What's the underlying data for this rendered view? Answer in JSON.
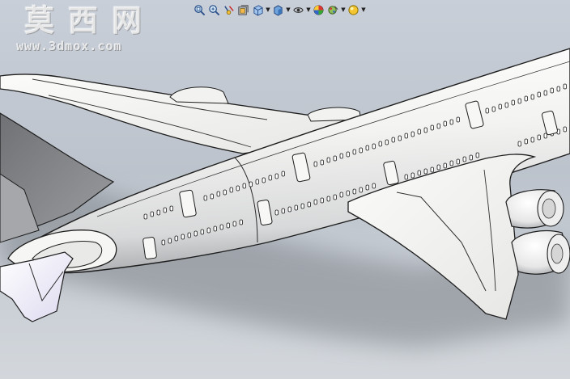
{
  "watermark": {
    "title_cn": "莫西网",
    "url": "www.3dmox.com"
  },
  "toolbar": {
    "buttons": [
      {
        "name": "zoom-to-fit-icon",
        "dropdown": false
      },
      {
        "name": "zoom-to-area-icon",
        "dropdown": false
      },
      {
        "name": "previous-view-icon",
        "dropdown": false
      },
      {
        "name": "section-view-icon",
        "dropdown": false
      },
      {
        "name": "view-orientation-icon",
        "dropdown": true
      },
      {
        "name": "display-style-icon",
        "dropdown": true
      },
      {
        "name": "hide-show-items-icon",
        "dropdown": true
      },
      {
        "name": "edit-appearance-icon",
        "dropdown": false
      },
      {
        "name": "apply-scene-icon",
        "dropdown": true
      },
      {
        "name": "view-settings-icon",
        "dropdown": true
      }
    ]
  },
  "colors": {
    "background_top": "#c9cfd8",
    "background_bottom": "#d3d7dc",
    "model_surface": "#f4f4f2",
    "model_shadow": "#8d9196",
    "edge_lines": "#1e1e1e",
    "window_fill": "#f8f8f8",
    "tail_fin": "#7d7f82",
    "stabilizer_tint": "#e4e2f2"
  }
}
